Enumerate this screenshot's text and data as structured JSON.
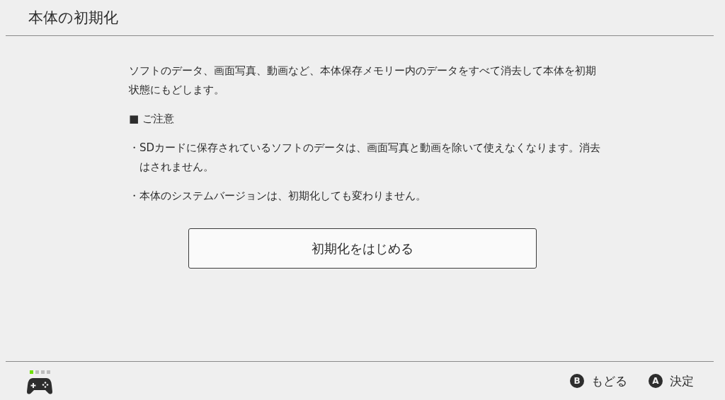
{
  "header": {
    "title": "本体の初期化"
  },
  "body": {
    "intro": "ソフトのデータ、画面写真、動画など、本体保存メモリー内のデータをすべて消去して本体を初期状態にもどします。",
    "notice_heading": "■ ご注意",
    "notes": [
      "・SDカードに保存されているソフトのデータは、画面写真と動画を除いて使えなくなります。消去はされません。",
      "・本体のシステムバージョンは、初期化しても変わりません。"
    ],
    "start_button": "初期化をはじめる"
  },
  "footer": {
    "player_lights": [
      {
        "on": true
      },
      {
        "on": false
      },
      {
        "on": false
      },
      {
        "on": false
      }
    ],
    "actions": [
      {
        "glyph": "B",
        "label": "もどる"
      },
      {
        "glyph": "A",
        "label": "決定"
      }
    ]
  }
}
